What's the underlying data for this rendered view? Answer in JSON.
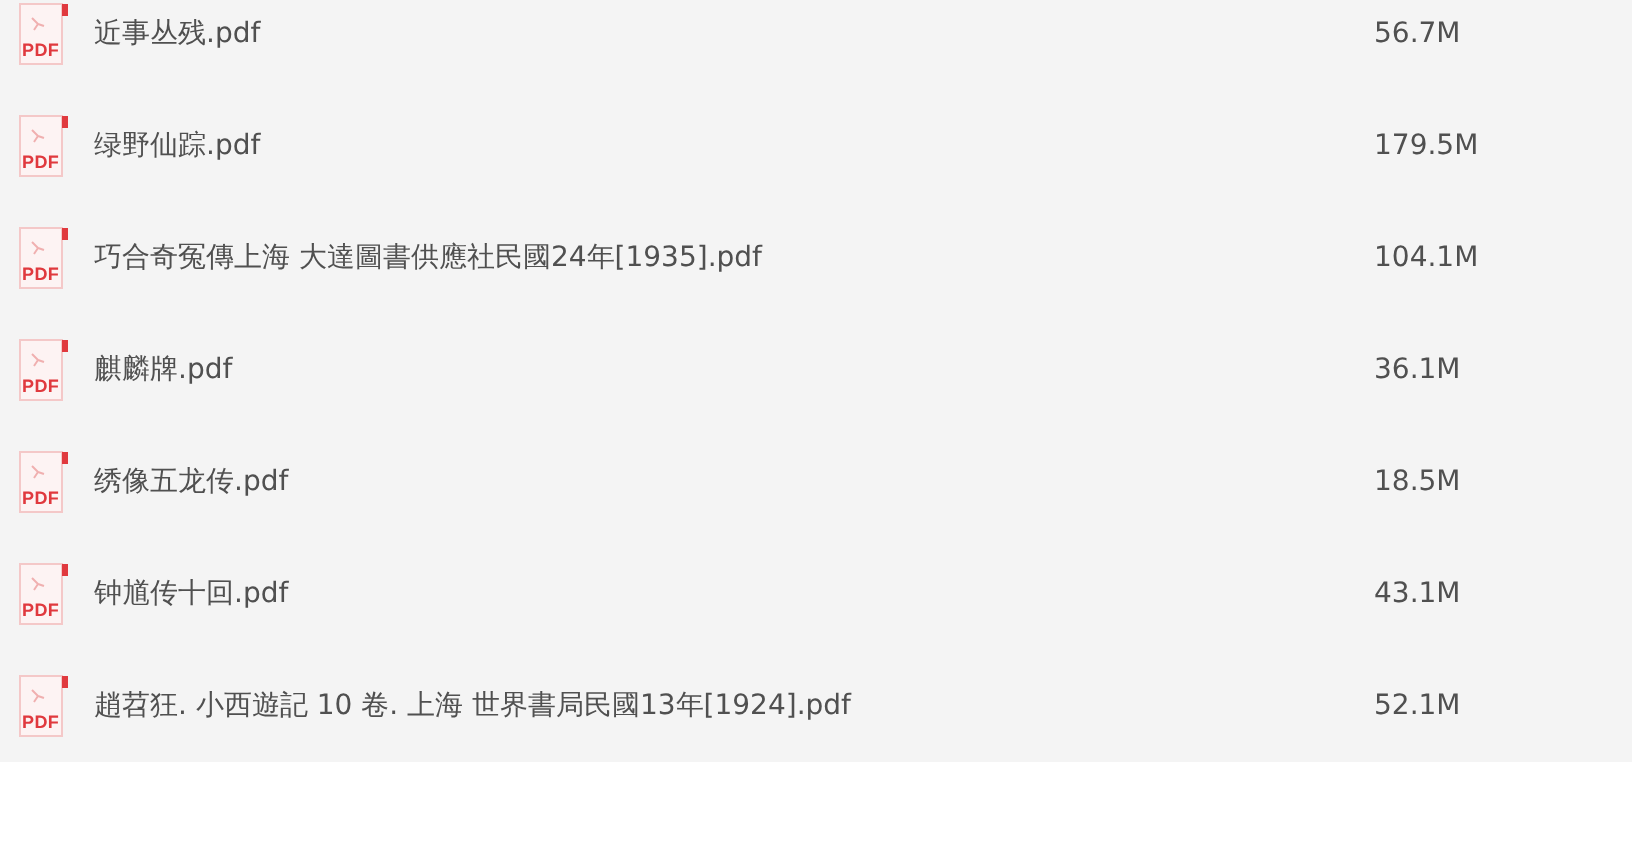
{
  "files": [
    {
      "icon_label": "PDF",
      "name": "近事丛残.pdf",
      "size": "56.7M"
    },
    {
      "icon_label": "PDF",
      "name": "绿野仙踪.pdf",
      "size": "179.5M"
    },
    {
      "icon_label": "PDF",
      "name": "巧合奇冤傳上海 大達圖書供應社民國24年[1935].pdf",
      "size": "104.1M"
    },
    {
      "icon_label": "PDF",
      "name": "麒麟牌.pdf",
      "size": "36.1M"
    },
    {
      "icon_label": "PDF",
      "name": "绣像五龙传.pdf",
      "size": "18.5M"
    },
    {
      "icon_label": "PDF",
      "name": "钟馗传十回.pdf",
      "size": "43.1M"
    },
    {
      "icon_label": "PDF",
      "name": "趙苕狂. 小西遊記 10 卷. 上海 世界書局民國13年[1924].pdf",
      "size": "52.1M"
    }
  ]
}
